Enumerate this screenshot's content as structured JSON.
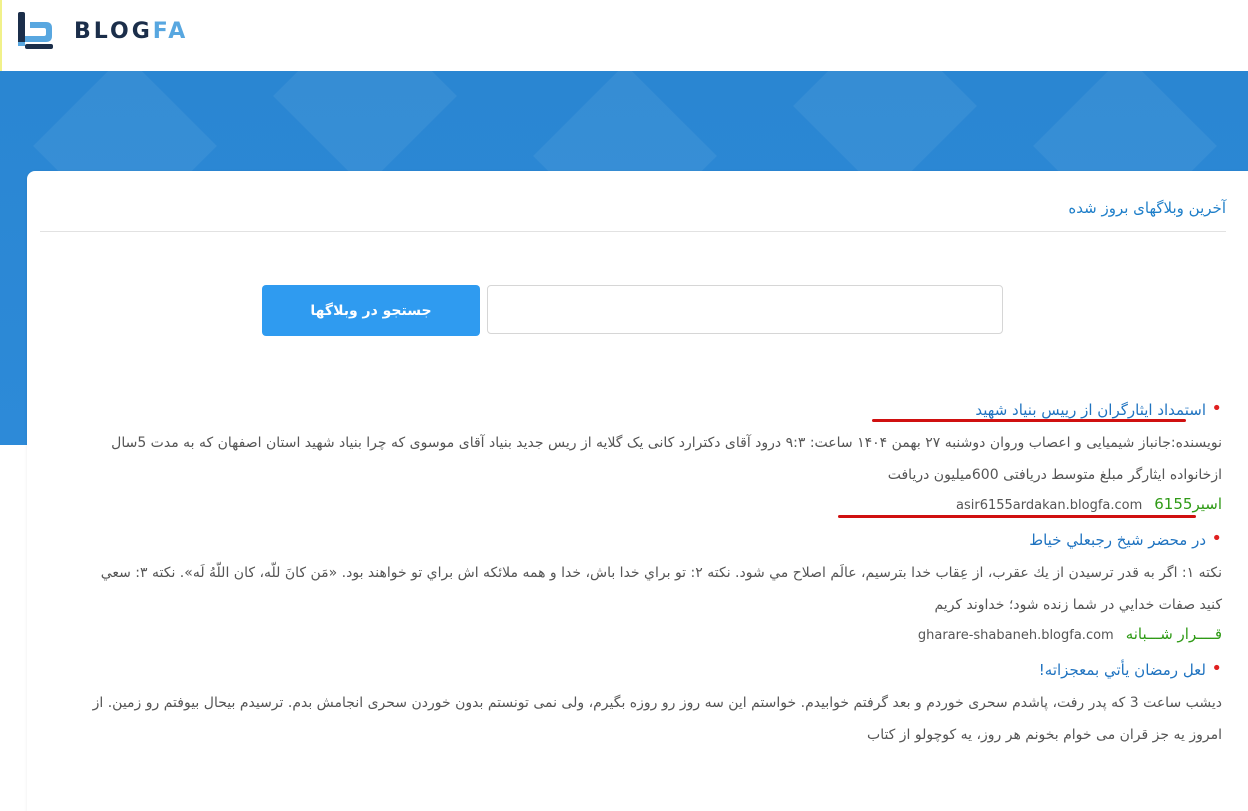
{
  "brand": {
    "blog": "BLOG",
    "fa": "FA"
  },
  "card": {
    "title": "آخرین وبلاگهای بروز شده"
  },
  "search": {
    "button_label": "جستجو در وبلاگها",
    "placeholder": ""
  },
  "posts": [
    {
      "title": "استمداد ایثارگران از رییس بنیاد شهید",
      "body": "نویسنده:جانباز شیمیایی و اعصاب وروان دوشنبه ۲۷ بهمن ۱۴۰۴ ساعت: ۹:۳ درود آقای دکترارد کانی یک گلایه از ریس جدید بنیاد آقای موسوی که چرا بنیاد شهید استان اصفهان که به مدت 5سال ازخانواده ایثارگر مبلغ متوسط دریافتی 600میلیون دریافت",
      "author": "اسیر6155",
      "url": "asir6155ardakan.blogfa.com"
    },
    {
      "title": "در محضر شيخ رجبعلي خياط",
      "body": "نكته ۱: اگر به قدر ترسيدن از يك عقرب، از عِقاب خدا بترسيم، عالَم اصلاح مي شود. نكته ۲: تو براي خدا باش، خدا و همه ملائكه اش براي تو خواهند بود. «مَن كانَ للّه، كان اللّهُ لَه». نكته ۳: سعي كنيد صفات خدايي در شما زنده شود؛ خداوند كريم",
      "author": "قــــرار شـــبانه",
      "url": "gharare-shabaneh.blogfa.com"
    },
    {
      "title": "لعل رمضان يأتي بمعجزاته!",
      "body": "دیشب ساعت 3 که پدر رفت، پاشدم سحری خوردم و بعد گرفتم خوابیدم. خواستم این سه روز رو روزه بگیرم، ولی نمی تونستم بدون خوردن سحری انجامش بدم. ترسیدم بیحال بیوفتم رو زمین. از امروز یه جز قران می خوام بخونم هر روز، یه کوچولو از کتاب",
      "author": "",
      "url": ""
    }
  ]
}
